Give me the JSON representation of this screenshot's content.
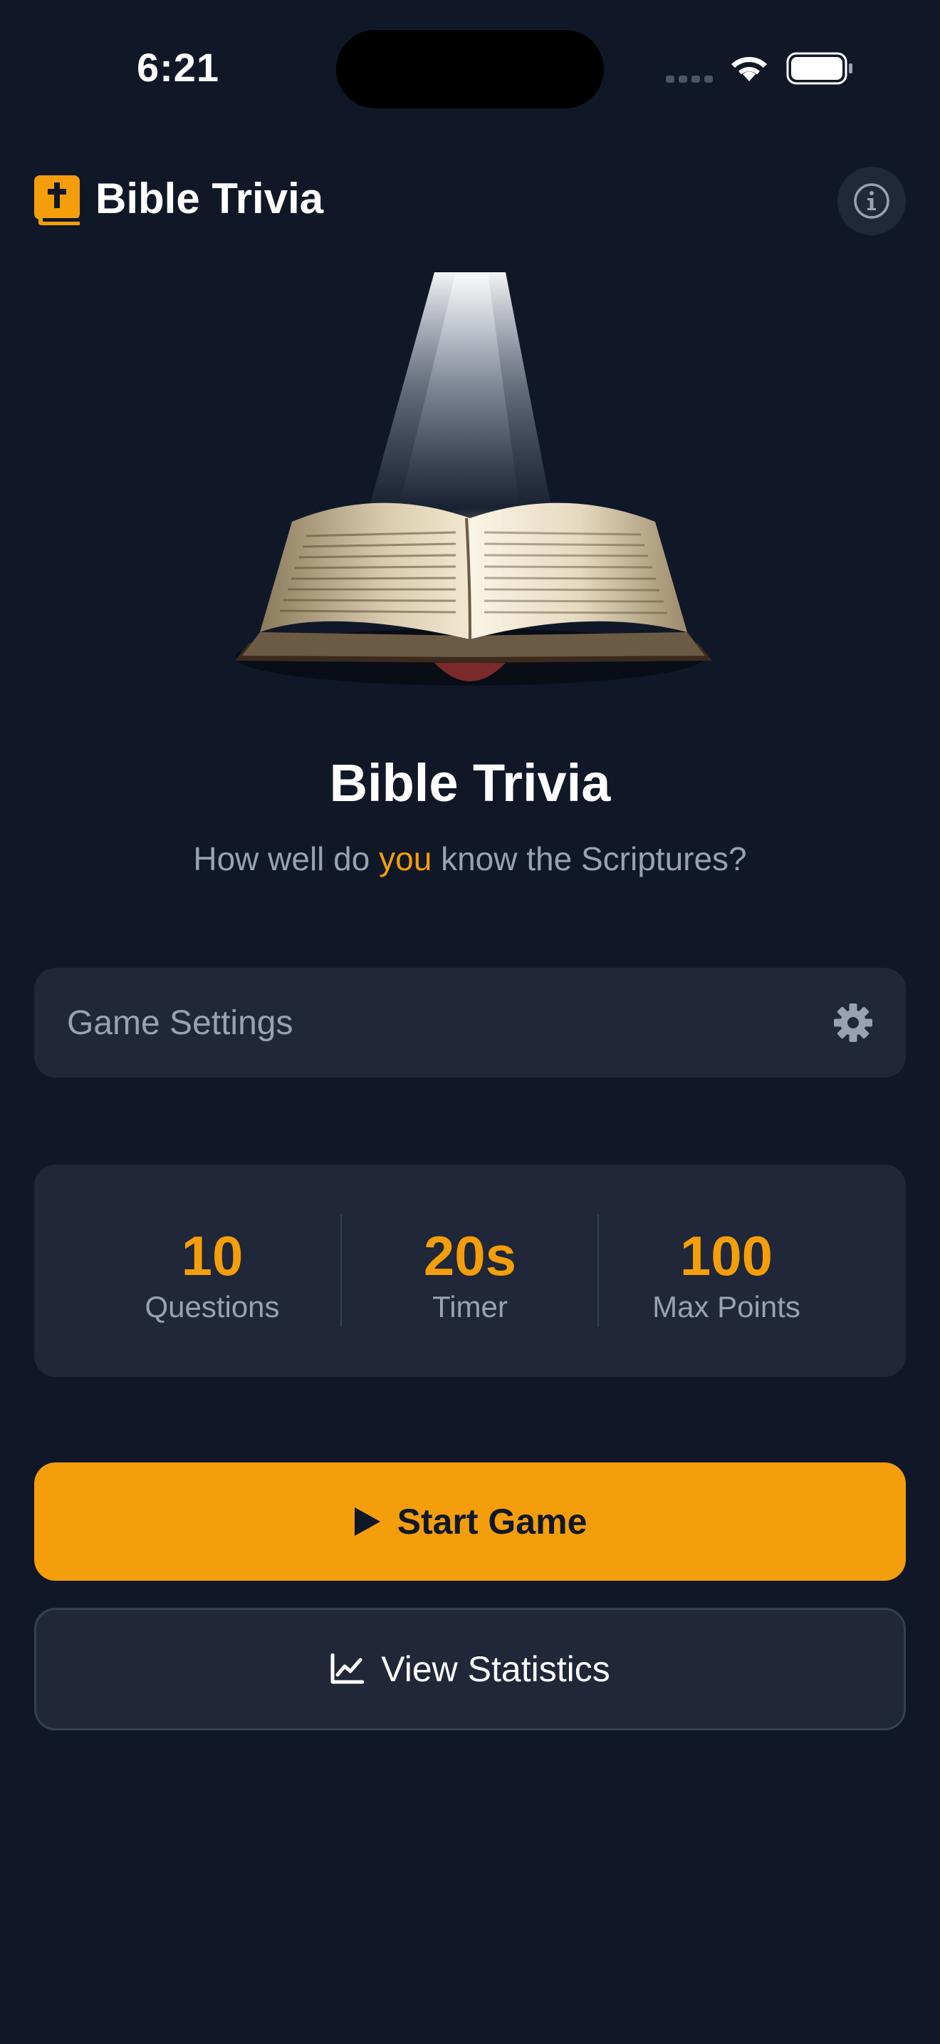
{
  "status_bar": {
    "time": "6:21"
  },
  "header": {
    "logo_icon": "bible-cross-icon",
    "title": "Bible Trivia",
    "info_icon": "info-icon"
  },
  "hero": {
    "image": "open-bible-with-light-beam",
    "title": "Bible Trivia",
    "subtitle_before": "How well do ",
    "subtitle_highlight": "you",
    "subtitle_after": " know the Scriptures?"
  },
  "settings": {
    "label": "Game Settings",
    "icon": "gear-icon"
  },
  "stats": [
    {
      "value": "10",
      "label": "Questions"
    },
    {
      "value": "20s",
      "label": "Timer"
    },
    {
      "value": "100",
      "label": "Max Points"
    }
  ],
  "actions": {
    "start_label": "Start Game",
    "start_icon": "play-icon",
    "statistics_label": "View Statistics",
    "statistics_icon": "line-chart-icon"
  },
  "colors": {
    "background": "#101828",
    "card": "#1f2738",
    "accent": "#f59e0b",
    "muted_text": "#98a2b3"
  }
}
